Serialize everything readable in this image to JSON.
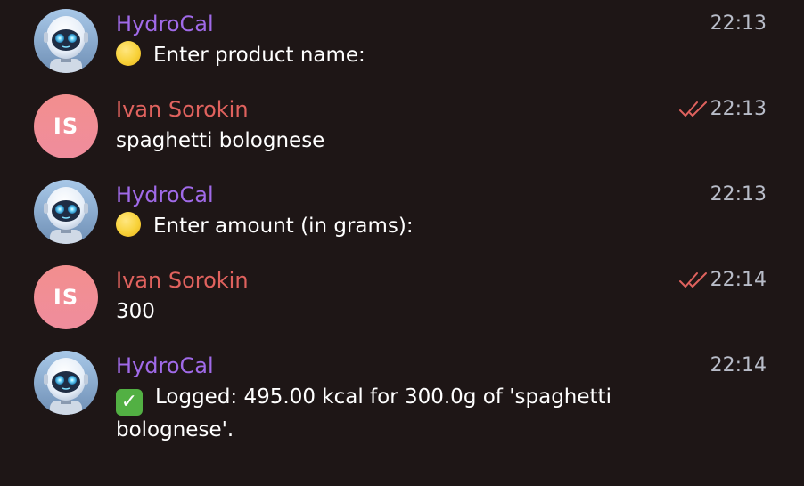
{
  "messages": [
    {
      "sender": "HydroCal",
      "kind": "bot",
      "time": "22:13",
      "icon": "yellow-circle-emoji",
      "text": "Enter product name:"
    },
    {
      "sender": "Ivan Sorokin",
      "kind": "user",
      "initials": "IS",
      "time": "22:13",
      "read": true,
      "text": "spaghetti bolognese"
    },
    {
      "sender": "HydroCal",
      "kind": "bot",
      "time": "22:13",
      "icon": "yellow-circle-emoji",
      "text": "Enter amount (in grams):"
    },
    {
      "sender": "Ivan Sorokin",
      "kind": "user",
      "initials": "IS",
      "time": "22:14",
      "read": true,
      "text": "300"
    },
    {
      "sender": "HydroCal",
      "kind": "bot",
      "time": "22:14",
      "icon": "check-mark-emoji",
      "text": "Logged: 495.00 kcal for 300.0g of 'spaghetti bolognese'."
    }
  ],
  "colors": {
    "background": "#1e1616",
    "bot_name": "#a06ae8",
    "user_name": "#e0625e",
    "timestamp": "#b8bcc8",
    "read_ticks": "#e0625e",
    "message_text": "#ffffff"
  }
}
